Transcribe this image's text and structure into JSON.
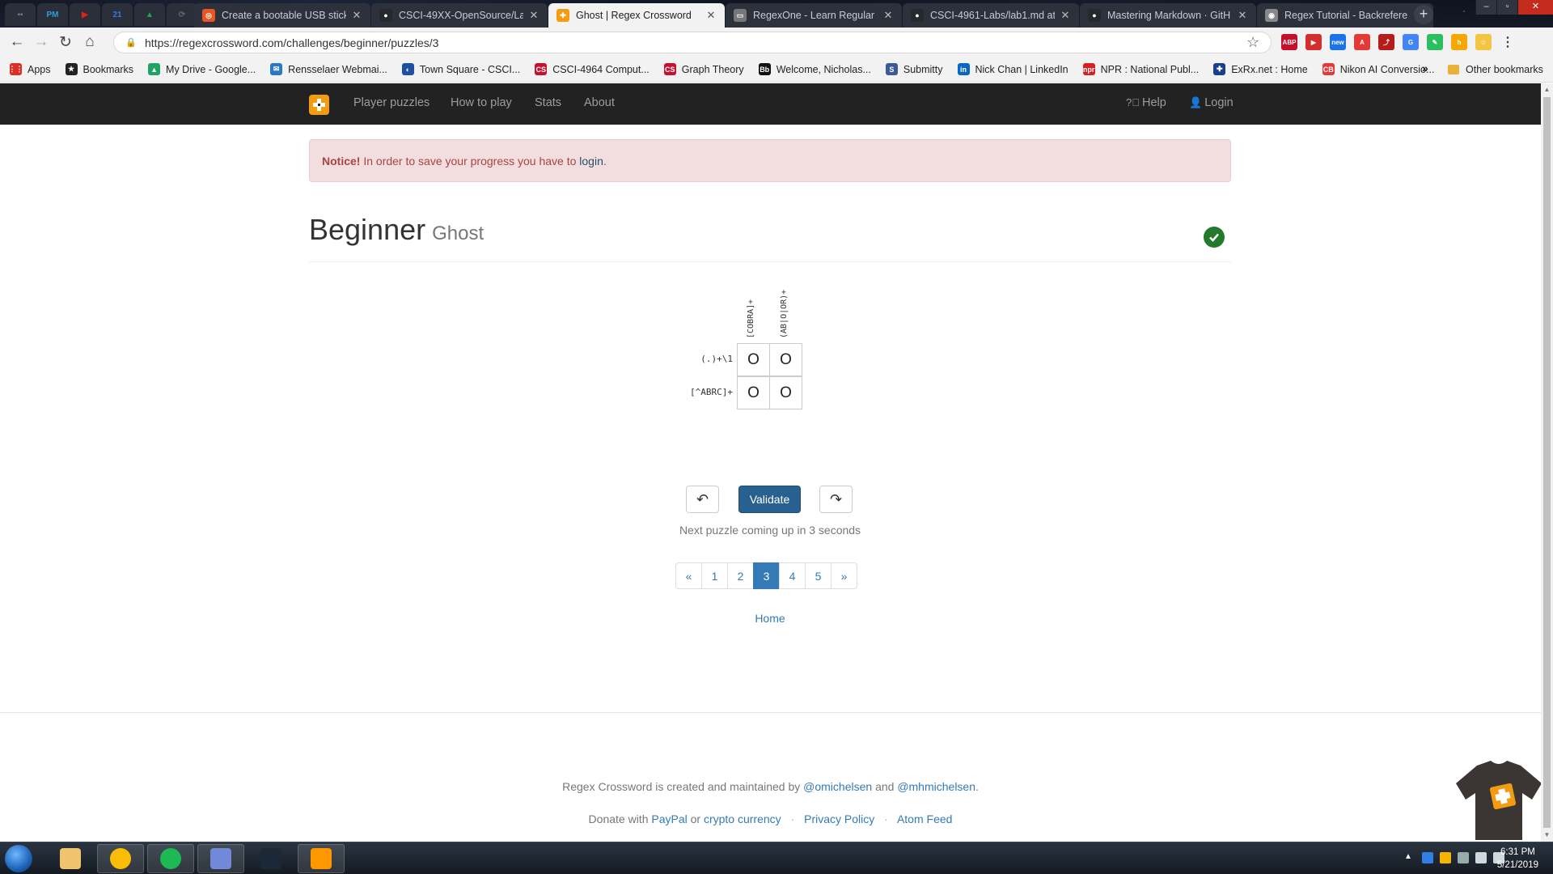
{
  "browser": {
    "pinned_tabs": [
      {
        "icon": "hangouts-icon",
        "color": "#6a7b8c",
        "glyph": "▪▪"
      },
      {
        "icon": "pm-icon",
        "color": "#2aa0d8",
        "glyph": "PM"
      },
      {
        "icon": "youtube-icon",
        "color": "#e62117",
        "glyph": "▶"
      },
      {
        "icon": "calendar-icon",
        "color": "#3b78e7",
        "glyph": "21"
      },
      {
        "icon": "google-drive-icon",
        "color": "#1fa463",
        "glyph": "▲"
      },
      {
        "icon": "hub-icon",
        "color": "#5b6b7b",
        "glyph": "⟳"
      }
    ],
    "tabs": [
      {
        "title": "Create a bootable USB stick",
        "favicon": "ubuntu-icon",
        "color": "#e95420",
        "glyph": "◎",
        "active": false
      },
      {
        "title": "CSCI-49XX-OpenSource/Lab",
        "favicon": "github-icon",
        "color": "#24292e",
        "glyph": "●",
        "active": false
      },
      {
        "title": "Ghost | Regex Crossword",
        "favicon": "regex-crossword-icon",
        "color": "#f39c12",
        "glyph": "✚",
        "active": true
      },
      {
        "title": "RegexOne - Learn Regular",
        "favicon": "regexone-icon",
        "color": "#777777",
        "glyph": "▭",
        "active": false
      },
      {
        "title": "CSCI-4961-Labs/lab1.md at",
        "favicon": "github-icon",
        "color": "#24292e",
        "glyph": "●",
        "active": false
      },
      {
        "title": "Mastering Markdown · GitH",
        "favicon": "github-icon",
        "color": "#24292e",
        "glyph": "●",
        "active": false
      },
      {
        "title": "Regex Tutorial - Backrefere",
        "favicon": "regex-tutorial-icon",
        "color": "#888888",
        "glyph": "◉",
        "active": false
      }
    ],
    "url": "https://regexcrossword.com/challenges/beginner/puzzles/3",
    "extensions": [
      {
        "icon": "abp-icon",
        "color": "#c70d2c",
        "glyph": "ABP"
      },
      {
        "icon": "cast-icon",
        "color": "#d32f2f",
        "glyph": "▶"
      },
      {
        "icon": "new-badge-icon",
        "color": "#1a73e8",
        "glyph": "new"
      },
      {
        "icon": "pdf-icon",
        "color": "#e53935",
        "glyph": "A"
      },
      {
        "icon": "acrobat-icon",
        "color": "#b71c1c",
        "glyph": "⤴"
      },
      {
        "icon": "translate-icon",
        "color": "#4285f4",
        "glyph": "G"
      },
      {
        "icon": "evernote-icon",
        "color": "#2dbe60",
        "glyph": "✎"
      },
      {
        "icon": "honey-icon",
        "color": "#f6a700",
        "glyph": "h"
      },
      {
        "icon": "profile-avatar-icon",
        "color": "#f4c542",
        "glyph": "☺"
      }
    ],
    "bookmarks": [
      {
        "label": "Apps",
        "icon": "apps-grid-icon",
        "color": "#d93025",
        "glyph": "⋮⋮"
      },
      {
        "label": "Bookmarks",
        "icon": "star-icon",
        "color": "#222222",
        "glyph": "★"
      },
      {
        "label": "My Drive - Google...",
        "icon": "google-drive-icon",
        "color": "#1fa463",
        "glyph": "▲"
      },
      {
        "label": "Rensselaer Webmai...",
        "icon": "webmail-icon",
        "color": "#2b79c2",
        "glyph": "✉"
      },
      {
        "label": "Town Square - CSCI...",
        "icon": "mattermost-icon",
        "color": "#1e4fa3",
        "glyph": "◐"
      },
      {
        "label": "CSCI-4964 Comput...",
        "icon": "gradescope-icon",
        "color": "#c4122f",
        "glyph": "CS"
      },
      {
        "label": "Graph Theory",
        "icon": "graph-theory-icon",
        "color": "#c4122f",
        "glyph": "CS"
      },
      {
        "label": "Welcome, Nicholas...",
        "icon": "blackboard-icon",
        "color": "#111111",
        "glyph": "Bb"
      },
      {
        "label": "Submitty",
        "icon": "submitty-icon",
        "color": "#3c5a99",
        "glyph": "S"
      },
      {
        "label": "Nick Chan | LinkedIn",
        "icon": "linkedin-icon",
        "color": "#0a66c2",
        "glyph": "in"
      },
      {
        "label": "NPR : National Publ...",
        "icon": "npr-icon",
        "color": "#d62021",
        "glyph": "npr"
      },
      {
        "label": "ExRx.net : Home",
        "icon": "exrx-icon",
        "color": "#1c3f8c",
        "glyph": "✚"
      },
      {
        "label": "Nikon AI Conversio...",
        "icon": "nikon-icon",
        "color": "#e53935",
        "glyph": "CB"
      }
    ],
    "more_label": "»",
    "other_bookmarks": "Other bookmarks"
  },
  "site": {
    "nav": {
      "player_puzzles": "Player puzzles",
      "how_to_play": "How to play",
      "stats": "Stats",
      "about": "About",
      "help": "Help",
      "login": "Login"
    },
    "alert": {
      "strong": "Notice!",
      "text": "In order to save your progress you have to",
      "link": "login",
      "end": "."
    },
    "title": "Beginner",
    "subtitle": "Ghost",
    "puzzle": {
      "column_clues": [
        "[COBRA]+",
        "(AB|O|OR)+"
      ],
      "row_clues": [
        "(.)+\\1",
        "[^ABRC]+"
      ],
      "cells": [
        [
          "O",
          "O"
        ],
        [
          "O",
          "O"
        ]
      ]
    },
    "controls": {
      "undo_glyph": "↶",
      "validate": "Validate",
      "redo_glyph": "↷",
      "next_message": "Next puzzle coming up in 3 seconds"
    },
    "pagination": {
      "prev": "«",
      "pages": [
        "1",
        "2",
        "3",
        "4",
        "5"
      ],
      "active_page": "3",
      "next": "»"
    },
    "home_link": "Home",
    "footer": {
      "created_text": "Regex Crossword is created and maintained by",
      "author1": "@omichelsen",
      "and": "and",
      "author2": "@mhmichelsen",
      "period": ".",
      "donate_text": "Donate with",
      "paypal": "PayPal",
      "or": "or",
      "crypto": "crypto currency",
      "sep": "·",
      "privacy": "Privacy Policy",
      "atom": "Atom Feed"
    },
    "colors": {
      "brand": "#f39c12",
      "primary": "#286090",
      "link": "#337ab7",
      "success": "#237a2c"
    }
  },
  "taskbar": {
    "apps": [
      {
        "icon": "file-explorer-icon",
        "open": false
      },
      {
        "icon": "chrome-icon",
        "open": true
      },
      {
        "icon": "spotify-icon",
        "open": true
      },
      {
        "icon": "discord-icon",
        "open": true
      },
      {
        "icon": "steam-icon",
        "open": false
      },
      {
        "icon": "sublime-text-icon",
        "open": true
      }
    ],
    "time": "6:31 PM",
    "date": "5/21/2019"
  }
}
